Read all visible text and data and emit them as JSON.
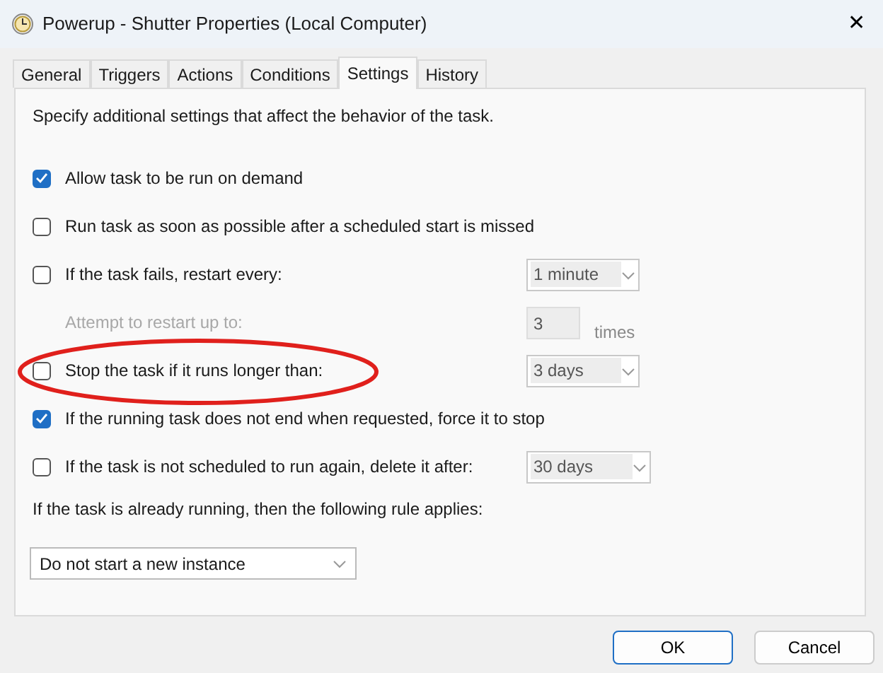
{
  "window": {
    "title": "Powerup - Shutter Properties (Local Computer)",
    "close": "✕"
  },
  "tabs": [
    {
      "label": "General",
      "selected": false
    },
    {
      "label": "Triggers",
      "selected": false
    },
    {
      "label": "Actions",
      "selected": false
    },
    {
      "label": "Conditions",
      "selected": false
    },
    {
      "label": "Settings",
      "selected": true
    },
    {
      "label": "History",
      "selected": false
    }
  ],
  "intro": "Specify additional settings that affect the behavior of the task.",
  "options": [
    {
      "kind": "checkbox",
      "label": "Allow task to be run on demand",
      "checked": true,
      "disabled": false
    },
    {
      "kind": "checkbox",
      "label": "Run task as soon as possible after a scheduled start is missed",
      "checked": false,
      "disabled": false
    },
    {
      "kind": "checkbox",
      "label": "If the task fails, restart every:",
      "checked": false,
      "disabled": false,
      "control": {
        "kind": "dropdown",
        "value": "1 minute",
        "disabled": true
      }
    },
    {
      "kind": "text",
      "label": "Attempt to restart up to:",
      "disabled": true,
      "control": {
        "kind": "number",
        "value": "3",
        "disabled": true,
        "suffix": "times"
      }
    },
    {
      "kind": "checkbox",
      "label": "Stop the task if it runs longer than:",
      "checked": false,
      "disabled": false,
      "circled": true,
      "control": {
        "kind": "dropdown",
        "value": "3 days",
        "disabled": true
      }
    },
    {
      "kind": "checkbox",
      "label": "If the running task does not end when requested, force it to stop",
      "checked": true,
      "disabled": false
    },
    {
      "kind": "checkbox",
      "label": "If the task is not scheduled to run again, delete it after:",
      "checked": false,
      "disabled": false,
      "control": {
        "kind": "dropdown",
        "value": "30 days",
        "disabled": true
      }
    }
  ],
  "rule": {
    "label": "If the task is already running, then the following rule applies:",
    "value": "Do not start a new instance"
  },
  "buttons": [
    {
      "label": "OK",
      "default": true
    },
    {
      "label": "Cancel",
      "default": false
    }
  ]
}
